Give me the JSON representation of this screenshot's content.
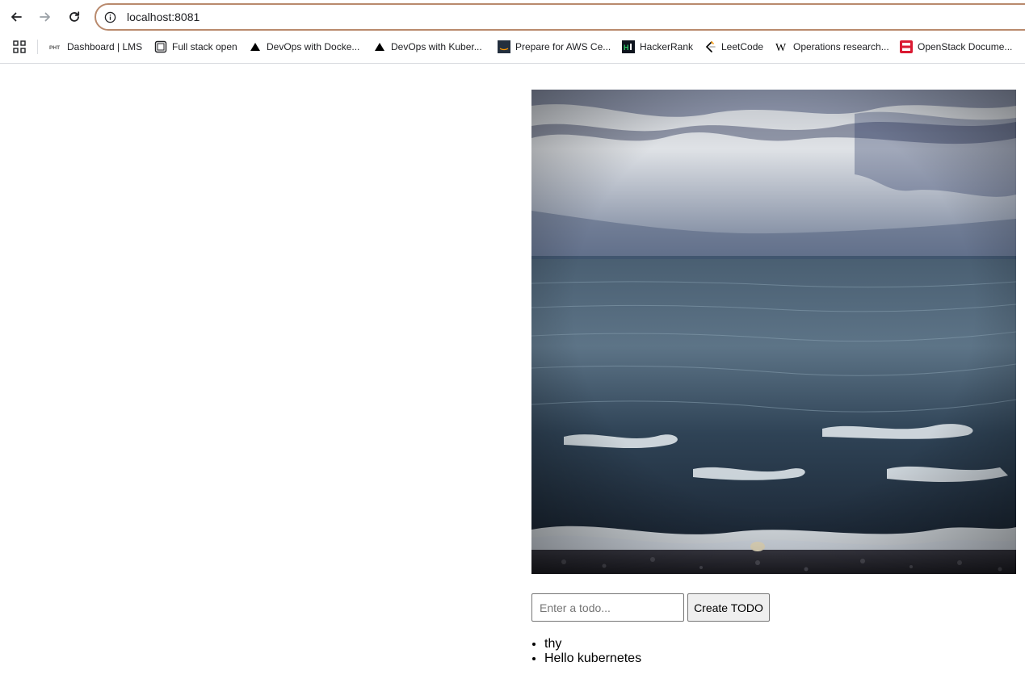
{
  "browser": {
    "url": "localhost:8081",
    "bookmarks": [
      {
        "label": "Dashboard | LMS",
        "icon": "lms-icon"
      },
      {
        "label": "Full stack open",
        "icon": "fullstack-icon"
      },
      {
        "label": "DevOps with Docke...",
        "icon": "triangle-icon"
      },
      {
        "label": "DevOps with Kuber...",
        "icon": "triangle-icon"
      },
      {
        "label": "Prepare for AWS Ce...",
        "icon": "aws-icon"
      },
      {
        "label": "HackerRank",
        "icon": "hackerrank-icon"
      },
      {
        "label": "LeetCode",
        "icon": "leetcode-icon"
      },
      {
        "label": "Operations research...",
        "icon": "wikipedia-icon"
      },
      {
        "label": "OpenStack Docume...",
        "icon": "openstack-icon"
      }
    ]
  },
  "page": {
    "image": {
      "subject": "sea-waves-photo"
    },
    "todo_input": {
      "placeholder": "Enter a todo..."
    },
    "create_button_label": "Create TODO",
    "todos": [
      "thy",
      "Hello kubernetes"
    ]
  },
  "colors": {
    "address_border": "#b98a6d",
    "openstack_red": "#da1a32",
    "hackerrank_green": "#2ec866"
  }
}
